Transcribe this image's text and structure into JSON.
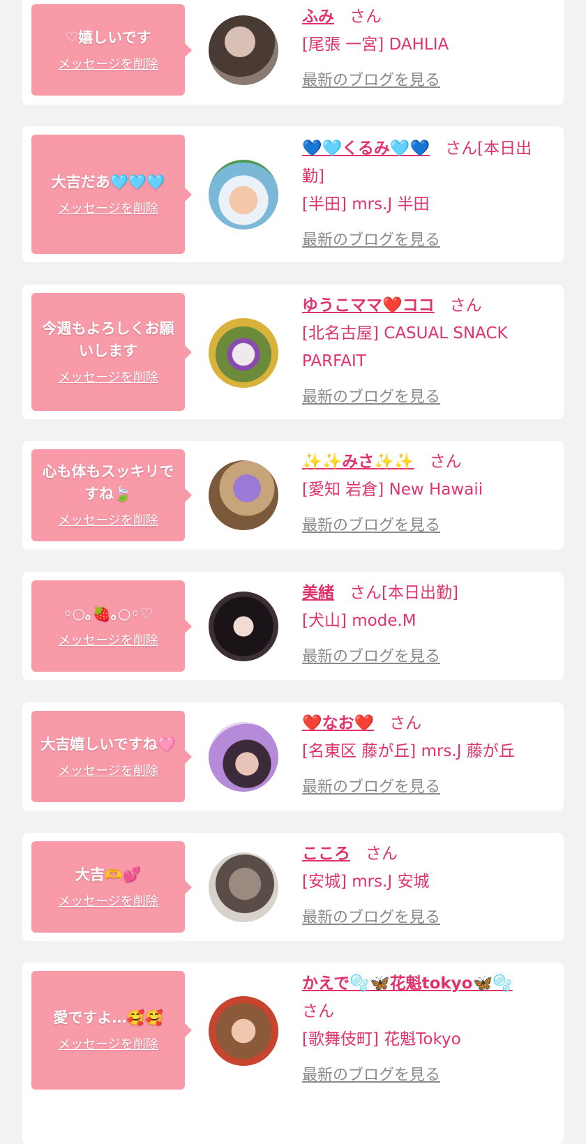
{
  "delete_label": "メッセージを削除",
  "blog_label": "最新のブログを見る",
  "honorific": "さん",
  "colors": {
    "bubble": "#f99aa9",
    "accent": "#e0336d",
    "link_gray": "#8a8a8a",
    "page_bg": "#f2f2f2"
  },
  "items": [
    {
      "message": "♡嬉しいです",
      "name": "ふみ",
      "honorific_line": "さん",
      "shop": "[尾張 一宮] DAHLIA",
      "avatar_icon": "avatar-photo-icon"
    },
    {
      "message": "大吉だあ🩵🩵🩵",
      "name": "💙🩵くるみ🩵💙",
      "honorific_line": "さん[本日出勤]",
      "shop": "[半田] mrs.J 半田",
      "avatar_icon": "avatar-photo-icon"
    },
    {
      "message": "今週もよろしくお願いします",
      "name": "ゆうこママ❤️ココ",
      "honorific_line": "さん",
      "shop": "[北名古屋] CASUAL SNACK PARFAIT",
      "avatar_icon": "avatar-photo-icon"
    },
    {
      "message": "心も体もスッキリですね🍃",
      "name": "✨✨みさ✨✨",
      "honorific_line": "さん",
      "shop": "[愛知 岩倉] New Hawaii",
      "avatar_icon": "avatar-photo-icon"
    },
    {
      "message": "◦○｡🍓｡○◦♡",
      "name": "美緒",
      "honorific_line": "さん[本日出勤]",
      "shop": "[犬山] mode.M",
      "avatar_icon": "avatar-photo-icon"
    },
    {
      "message": "大吉嬉しいですね🩷",
      "name": "❤️なお❤️",
      "honorific_line": "さん",
      "shop": "[名東区 藤が丘] mrs.J 藤が丘",
      "avatar_icon": "avatar-photo-icon"
    },
    {
      "message": "大吉🫶💕",
      "name": "こころ",
      "honorific_line": "さん",
      "shop": "[安城] mrs.J 安城",
      "avatar_icon": "avatar-photo-icon"
    },
    {
      "message": "愛ですよ…🥰🥰",
      "name": "かえで🫧🦋花魁tokyo🦋🫧",
      "honorific_line": "さん",
      "shop": "[歌舞伎町] 花魁Tokyo",
      "avatar_icon": "avatar-photo-icon"
    }
  ]
}
